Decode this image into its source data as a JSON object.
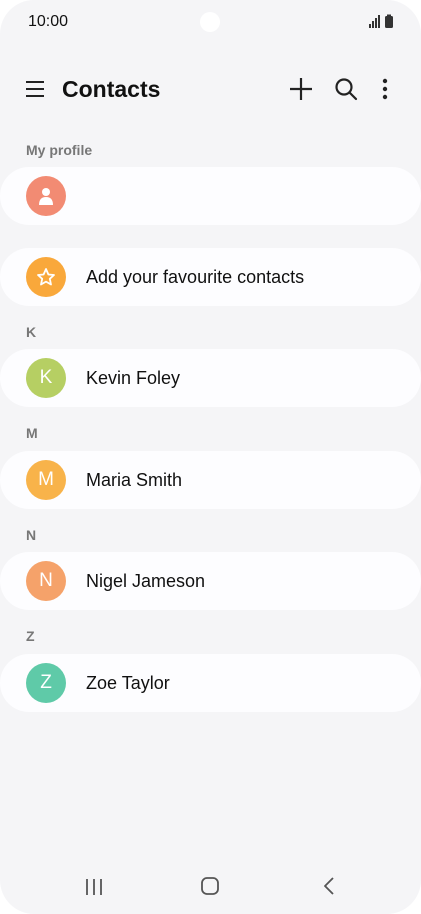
{
  "status_bar": {
    "time": "10:00"
  },
  "app_bar": {
    "title": "Contacts",
    "icons": [
      "menu-icon",
      "add-icon",
      "search-icon",
      "more-vertical-icon"
    ]
  },
  "profile": {
    "section_label": "My profile",
    "avatar_icon": "person-icon"
  },
  "favourites": {
    "label": "Add your favourite contacts",
    "avatar_icon": "star-icon"
  },
  "groups": [
    {
      "letter": "K",
      "contacts": [
        {
          "initial": "K",
          "name": "Kevin Foley",
          "color": "#b6cf63"
        }
      ]
    },
    {
      "letter": "M",
      "contacts": [
        {
          "initial": "M",
          "name": "Maria Smith",
          "color": "#f8b34a"
        }
      ]
    },
    {
      "letter": "N",
      "contacts": [
        {
          "initial": "N",
          "name": "Nigel Jameson",
          "color": "#f5a26a"
        }
      ]
    },
    {
      "letter": "Z",
      "contacts": [
        {
          "initial": "Z",
          "name": "Zoe Taylor",
          "color": "#5fcaa8"
        }
      ]
    }
  ],
  "colors": {
    "profile_avatar": "#f28b73",
    "favourites_avatar": "#f9a83b",
    "background": "#f5f5f7",
    "card": "#fdfdff"
  }
}
